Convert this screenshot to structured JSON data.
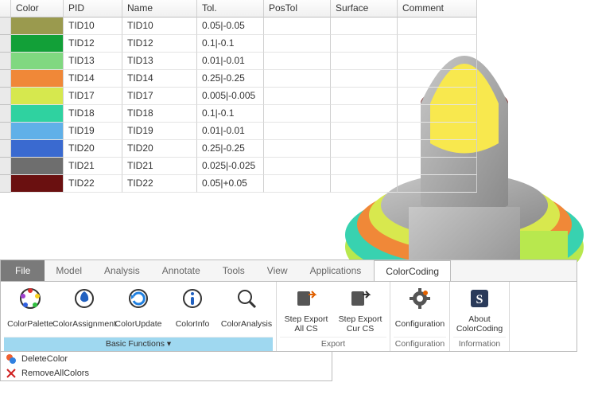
{
  "table": {
    "headers": [
      "",
      "Color",
      "PID",
      "Name",
      "Tol.",
      "PosTol",
      "Surface",
      "Comment"
    ],
    "rows": [
      {
        "color": "#9a9a4e",
        "pid": "TID10",
        "name": "TID10",
        "tol": "0.05|-0.05"
      },
      {
        "color": "#12a038",
        "pid": "TID12",
        "name": "TID12",
        "tol": "0.1|-0.1"
      },
      {
        "color": "#80d880",
        "pid": "TID13",
        "name": "TID13",
        "tol": "0.01|-0.01"
      },
      {
        "color": "#f08838",
        "pid": "TID14",
        "name": "TID14",
        "tol": "0.25|-0.25"
      },
      {
        "color": "#d6e84e",
        "pid": "TID17",
        "name": "TID17",
        "tol": "0.005|-0.005"
      },
      {
        "color": "#2fd2a0",
        "pid": "TID18",
        "name": "TID18",
        "tol": "0.1|-0.1"
      },
      {
        "color": "#60b0e8",
        "pid": "TID19",
        "name": "TID19",
        "tol": "0.01|-0.01"
      },
      {
        "color": "#3a6ad0",
        "pid": "TID20",
        "name": "TID20",
        "tol": "0.25|-0.25"
      },
      {
        "color": "#6e6e6e",
        "pid": "TID21",
        "name": "TID21",
        "tol": "0.025|-0.025"
      },
      {
        "color": "#6a1010",
        "pid": "TID22",
        "name": "TID22",
        "tol": "0.05|+0.05"
      }
    ]
  },
  "ribbon": {
    "file": "File",
    "tabs": [
      "Model",
      "Analysis",
      "Annotate",
      "Tools",
      "View",
      "Applications",
      "ColorCoding"
    ],
    "groups": {
      "basic": {
        "label": "Basic Functions",
        "items": [
          {
            "label": "ColorPalette"
          },
          {
            "label": "ColorAssignment"
          },
          {
            "label": "ColorUpdate"
          },
          {
            "label": "ColorInfo"
          },
          {
            "label": "ColorAnalysis"
          }
        ]
      },
      "export": {
        "label": "Export",
        "items": [
          {
            "label": "Step Export All CS"
          },
          {
            "label": "Step Export Cur CS"
          }
        ]
      },
      "config": {
        "label": "Configuration",
        "items": [
          {
            "label": "Configuration"
          }
        ]
      },
      "info": {
        "label": "Information",
        "items": [
          {
            "label": "About ColorCoding"
          }
        ]
      }
    },
    "dropdown": [
      {
        "label": "DeleteColor"
      },
      {
        "label": "RemoveAllColors"
      }
    ]
  }
}
